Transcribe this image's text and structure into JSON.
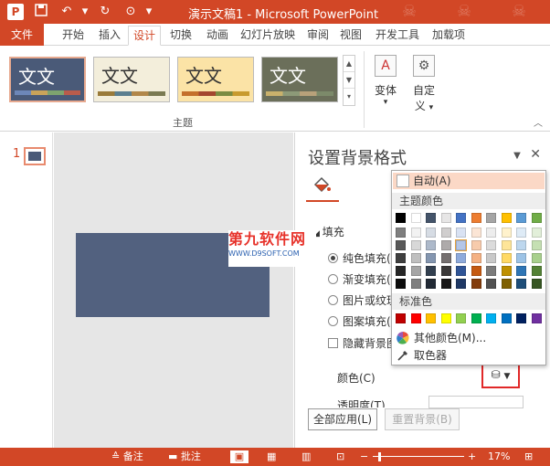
{
  "titlebar": {
    "app_icon": "P",
    "title": "演示文稿1 - Microsoft PowerPoint",
    "icons": [
      "powerpoint-app-icon",
      "save-icon",
      "undo-icon",
      "redo-icon",
      "present-icon"
    ]
  },
  "tabs": [
    {
      "label": "文件"
    },
    {
      "label": "开始"
    },
    {
      "label": "插入"
    },
    {
      "label": "设计"
    },
    {
      "label": "切换"
    },
    {
      "label": "动画"
    },
    {
      "label": "幻灯片放映"
    },
    {
      "label": "审阅"
    },
    {
      "label": "视图"
    },
    {
      "label": "开发工具"
    },
    {
      "label": "加载项"
    }
  ],
  "ribbon": {
    "themes": [
      {
        "label": "文文"
      },
      {
        "label": "文文"
      },
      {
        "label": "文文"
      },
      {
        "label": "文文"
      }
    ],
    "group_label": "主题",
    "variant_label": "变体",
    "customize_label": "自定义",
    "customize_label_2": "义",
    "customize_label_1": "自定"
  },
  "thumbs": {
    "number": "1"
  },
  "pane": {
    "title": "设置背景格式",
    "fill_heading": "填充",
    "options": [
      {
        "label": "纯色填充(",
        "selected": true
      },
      {
        "label": "渐变填充(",
        "selected": false
      },
      {
        "label": "图片或纹理",
        "selected": false
      },
      {
        "label": "图案填充(",
        "selected": false
      }
    ],
    "hide_bg_label": "隐藏背景图",
    "color_label": "颜色(C)",
    "transparency_label": "透明度(T)",
    "apply_all_label": "全部应用(L)",
    "reset_label": "重置背景(B)"
  },
  "watermark": {
    "line1": "第九软件网",
    "line2": "WWW.D9SOFT.COM"
  },
  "dropdown": {
    "auto_label": "自动(A)",
    "theme_colors_label": "主题颜色",
    "standard_colors_label": "标准色",
    "more_colors_label": "其他颜色(M)...",
    "eyedropper_label": "取色器",
    "theme_top": [
      "#000000",
      "#ffffff",
      "#44546a",
      "#e7e6e6",
      "#4472c4",
      "#ed7d31",
      "#a5a5a5",
      "#ffc000",
      "#5b9bd5",
      "#70ad47"
    ],
    "theme_shades": [
      [
        "#7f7f7f",
        "#f2f2f2",
        "#d6dce4",
        "#d0cece",
        "#d9e2f3",
        "#fbe5d5",
        "#ededed",
        "#fff2cc",
        "#deebf6",
        "#e2efd9"
      ],
      [
        "#595959",
        "#d8d8d8",
        "#adb9ca",
        "#aeaaaa",
        "#b4c6e7",
        "#f7cbac",
        "#dbdbdb",
        "#fee599",
        "#bdd7ee",
        "#c5e0b3"
      ],
      [
        "#3f3f3f",
        "#bfbfbf",
        "#8496b0",
        "#757070",
        "#8eaadb",
        "#f4b183",
        "#c9c9c9",
        "#ffd965",
        "#9dc3e6",
        "#a8d08d"
      ],
      [
        "#262626",
        "#a5a5a5",
        "#323f4f",
        "#3a3838",
        "#2f5496",
        "#c55a11",
        "#7b7b7b",
        "#bf9000",
        "#2e75b5",
        "#538135"
      ],
      [
        "#0c0c0c",
        "#7f7f7f",
        "#222a35",
        "#171616",
        "#1f3864",
        "#833c0b",
        "#525252",
        "#7f6000",
        "#1e4e79",
        "#375623"
      ]
    ],
    "standard": [
      "#c00000",
      "#ff0000",
      "#ffc000",
      "#ffff00",
      "#92d050",
      "#00b050",
      "#00b0f0",
      "#0070c0",
      "#002060",
      "#7030a0"
    ]
  },
  "statusbar": {
    "notes_label": "备注",
    "comments_label": "批注",
    "zoom": "17%"
  },
  "colors": {
    "accent": "#d24726",
    "slide": "#52617f"
  }
}
